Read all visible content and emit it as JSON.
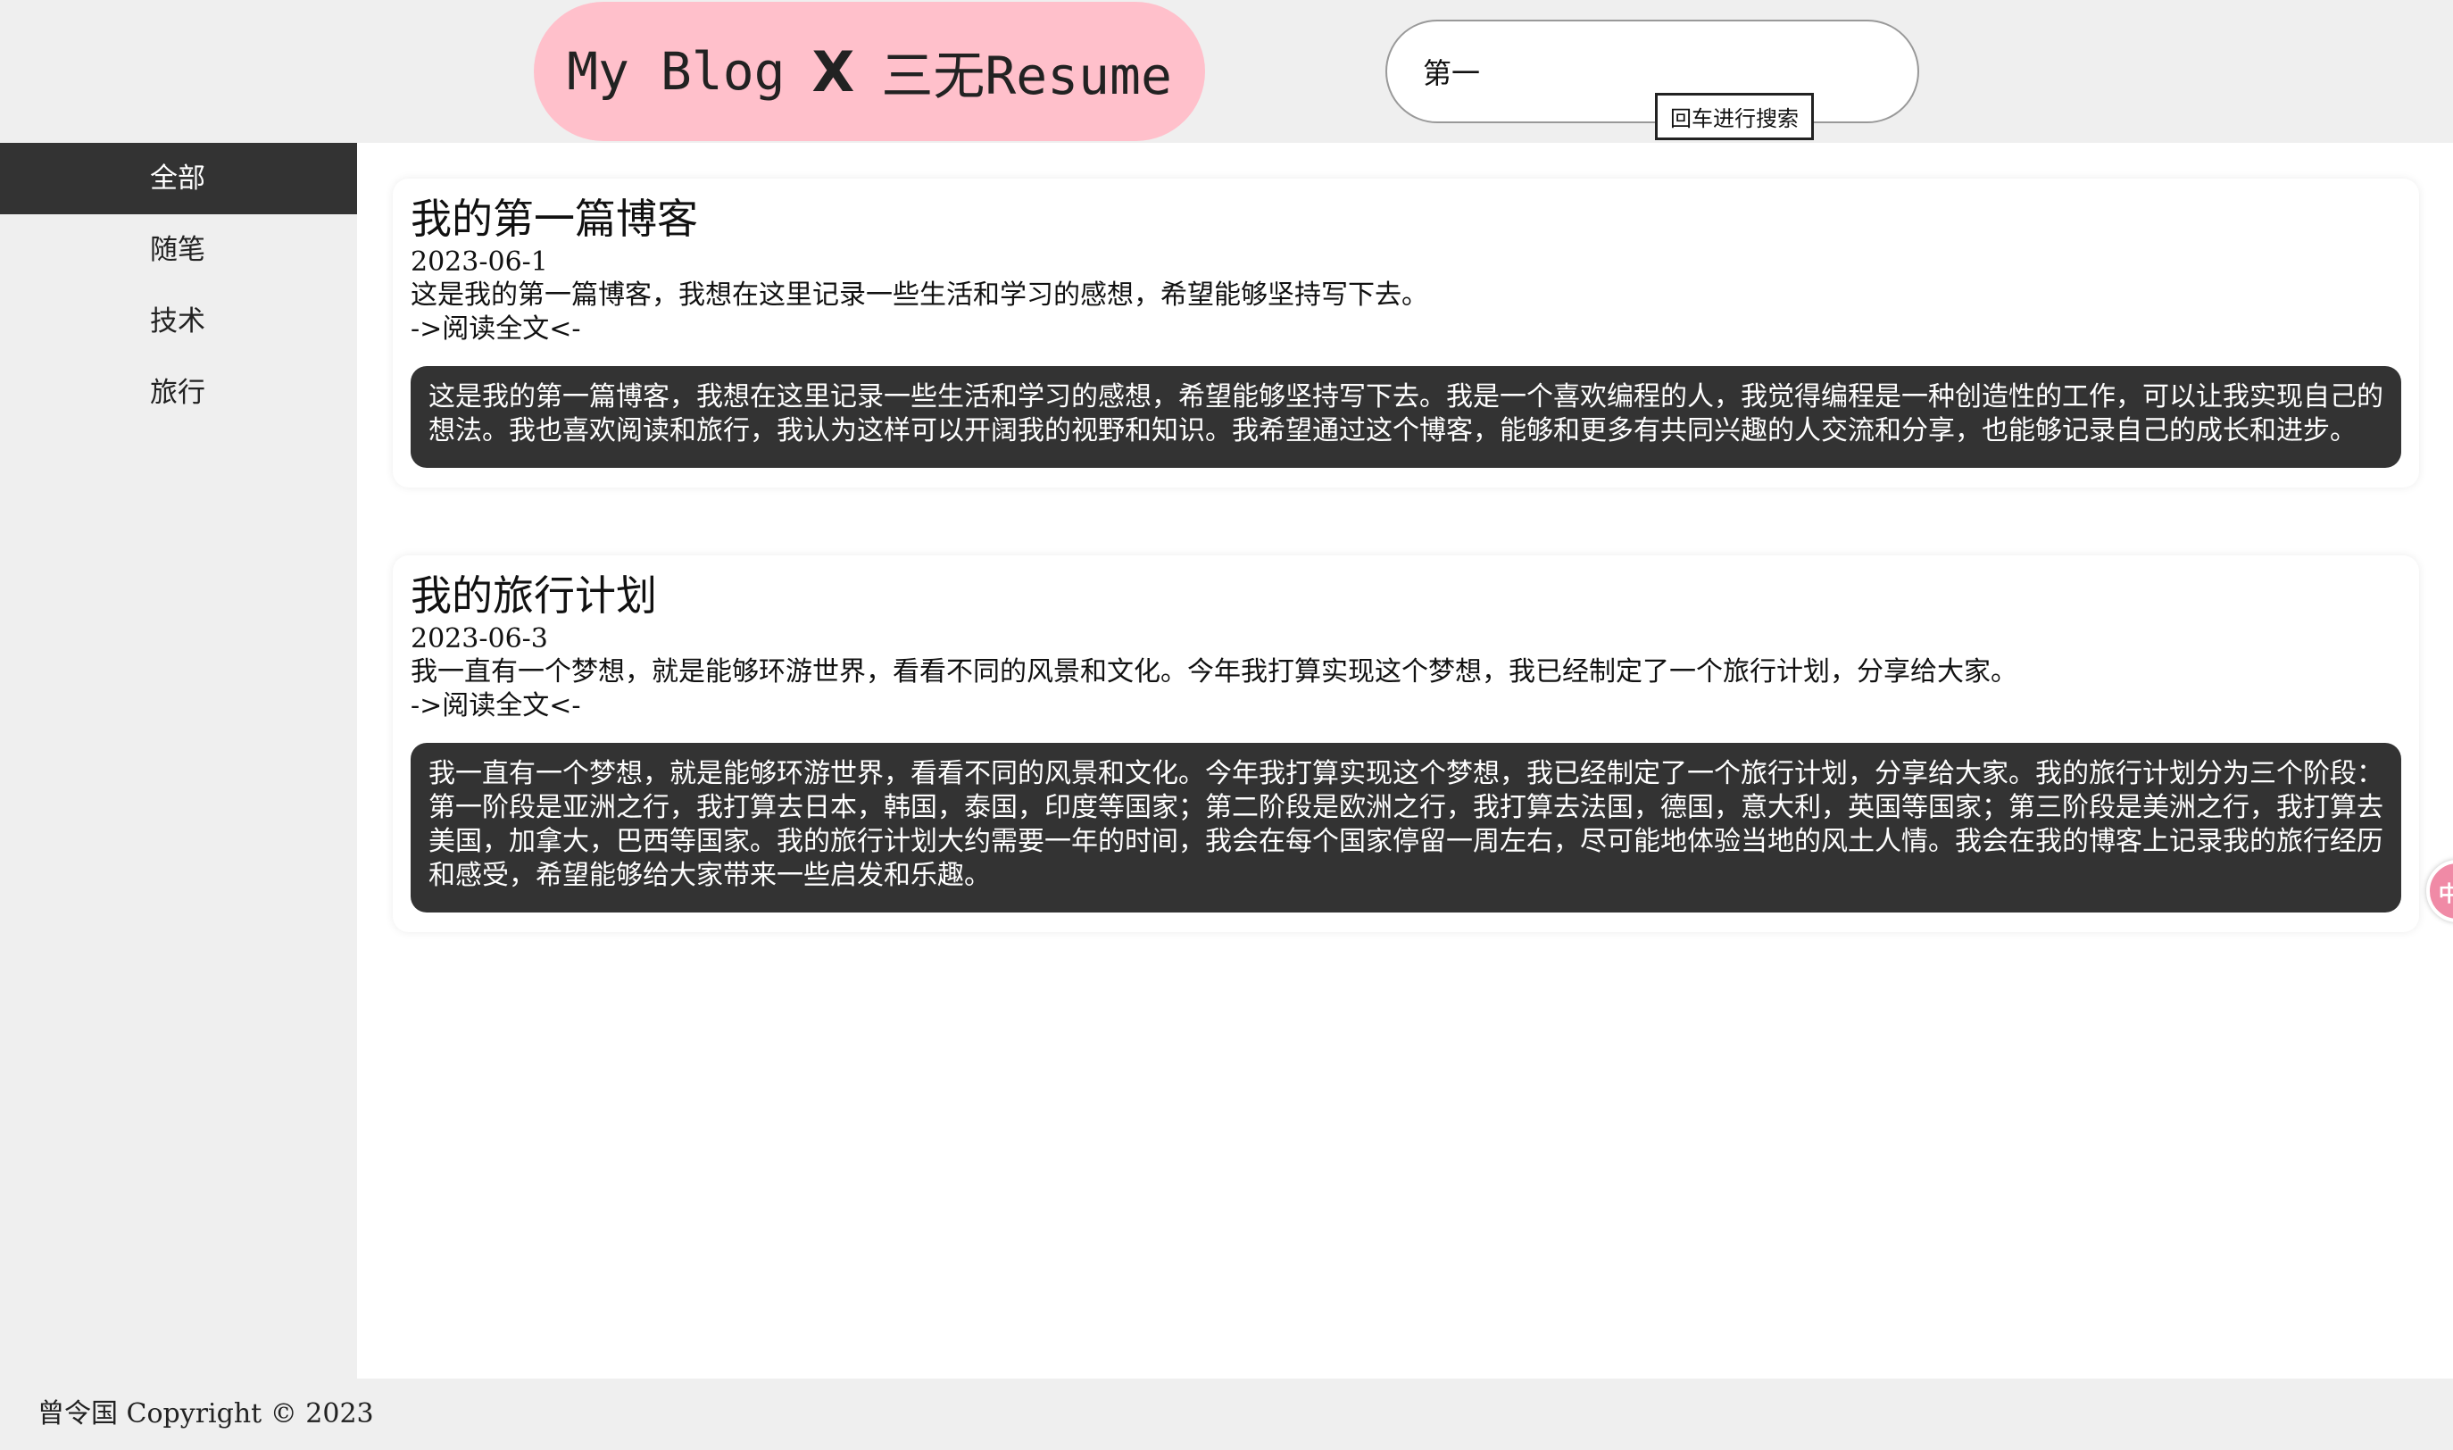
{
  "header": {
    "logo_left": "My Blog",
    "logo_x": "X",
    "logo_right": "三无Resume",
    "search_value": "第一",
    "search_hint": "回车进行搜索"
  },
  "sidebar": {
    "items": [
      {
        "label": "全部",
        "active": true
      },
      {
        "label": "随笔",
        "active": false
      },
      {
        "label": "技术",
        "active": false
      },
      {
        "label": "旅行",
        "active": false
      }
    ]
  },
  "posts": [
    {
      "title": "我的第一篇博客",
      "date": "2023-06-1",
      "summary": "这是我的第一篇博客，我想在这里记录一些生活和学习的感想，希望能够坚持写下去。",
      "link": "->阅读全文<-",
      "content": "这是我的第一篇博客，我想在这里记录一些生活和学习的感想，希望能够坚持写下去。我是一个喜欢编程的人，我觉得编程是一种创造性的工作，可以让我实现自己的想法。我也喜欢阅读和旅行，我认为这样可以开阔我的视野和知识。我希望通过这个博客，能够和更多有共同兴趣的人交流和分享，也能够记录自己的成长和进步。"
    },
    {
      "title": "我的旅行计划",
      "date": "2023-06-3",
      "summary": "我一直有一个梦想，就是能够环游世界，看看不同的风景和文化。今年我打算实现这个梦想，我已经制定了一个旅行计划，分享给大家。",
      "link": "->阅读全文<-",
      "content": "我一直有一个梦想，就是能够环游世界，看看不同的风景和文化。今年我打算实现这个梦想，我已经制定了一个旅行计划，分享给大家。我的旅行计划分为三个阶段：第一阶段是亚洲之行，我打算去日本，韩国，泰国，印度等国家；第二阶段是欧洲之行，我打算去法国，德国，意大利，英国等国家；第三阶段是美洲之行，我打算去美国，加拿大，巴西等国家。我的旅行计划大约需要一年的时间，我会在每个国家停留一周左右，尽可能地体验当地的风土人情。我会在我的博客上记录我的旅行经历和感受，希望能够给大家带来一些启发和乐趣。"
    }
  ],
  "fab": {
    "icon": "translate-icon",
    "glyph": "中A"
  },
  "footer": {
    "text": "曾令国 Copyright © 2023"
  },
  "colors": {
    "logo_bg": "#ffc0cb",
    "active_nav_bg": "#333333",
    "content_block_bg": "#333333",
    "page_bg": "#efefef",
    "fab_bg": "#f08aa6"
  }
}
